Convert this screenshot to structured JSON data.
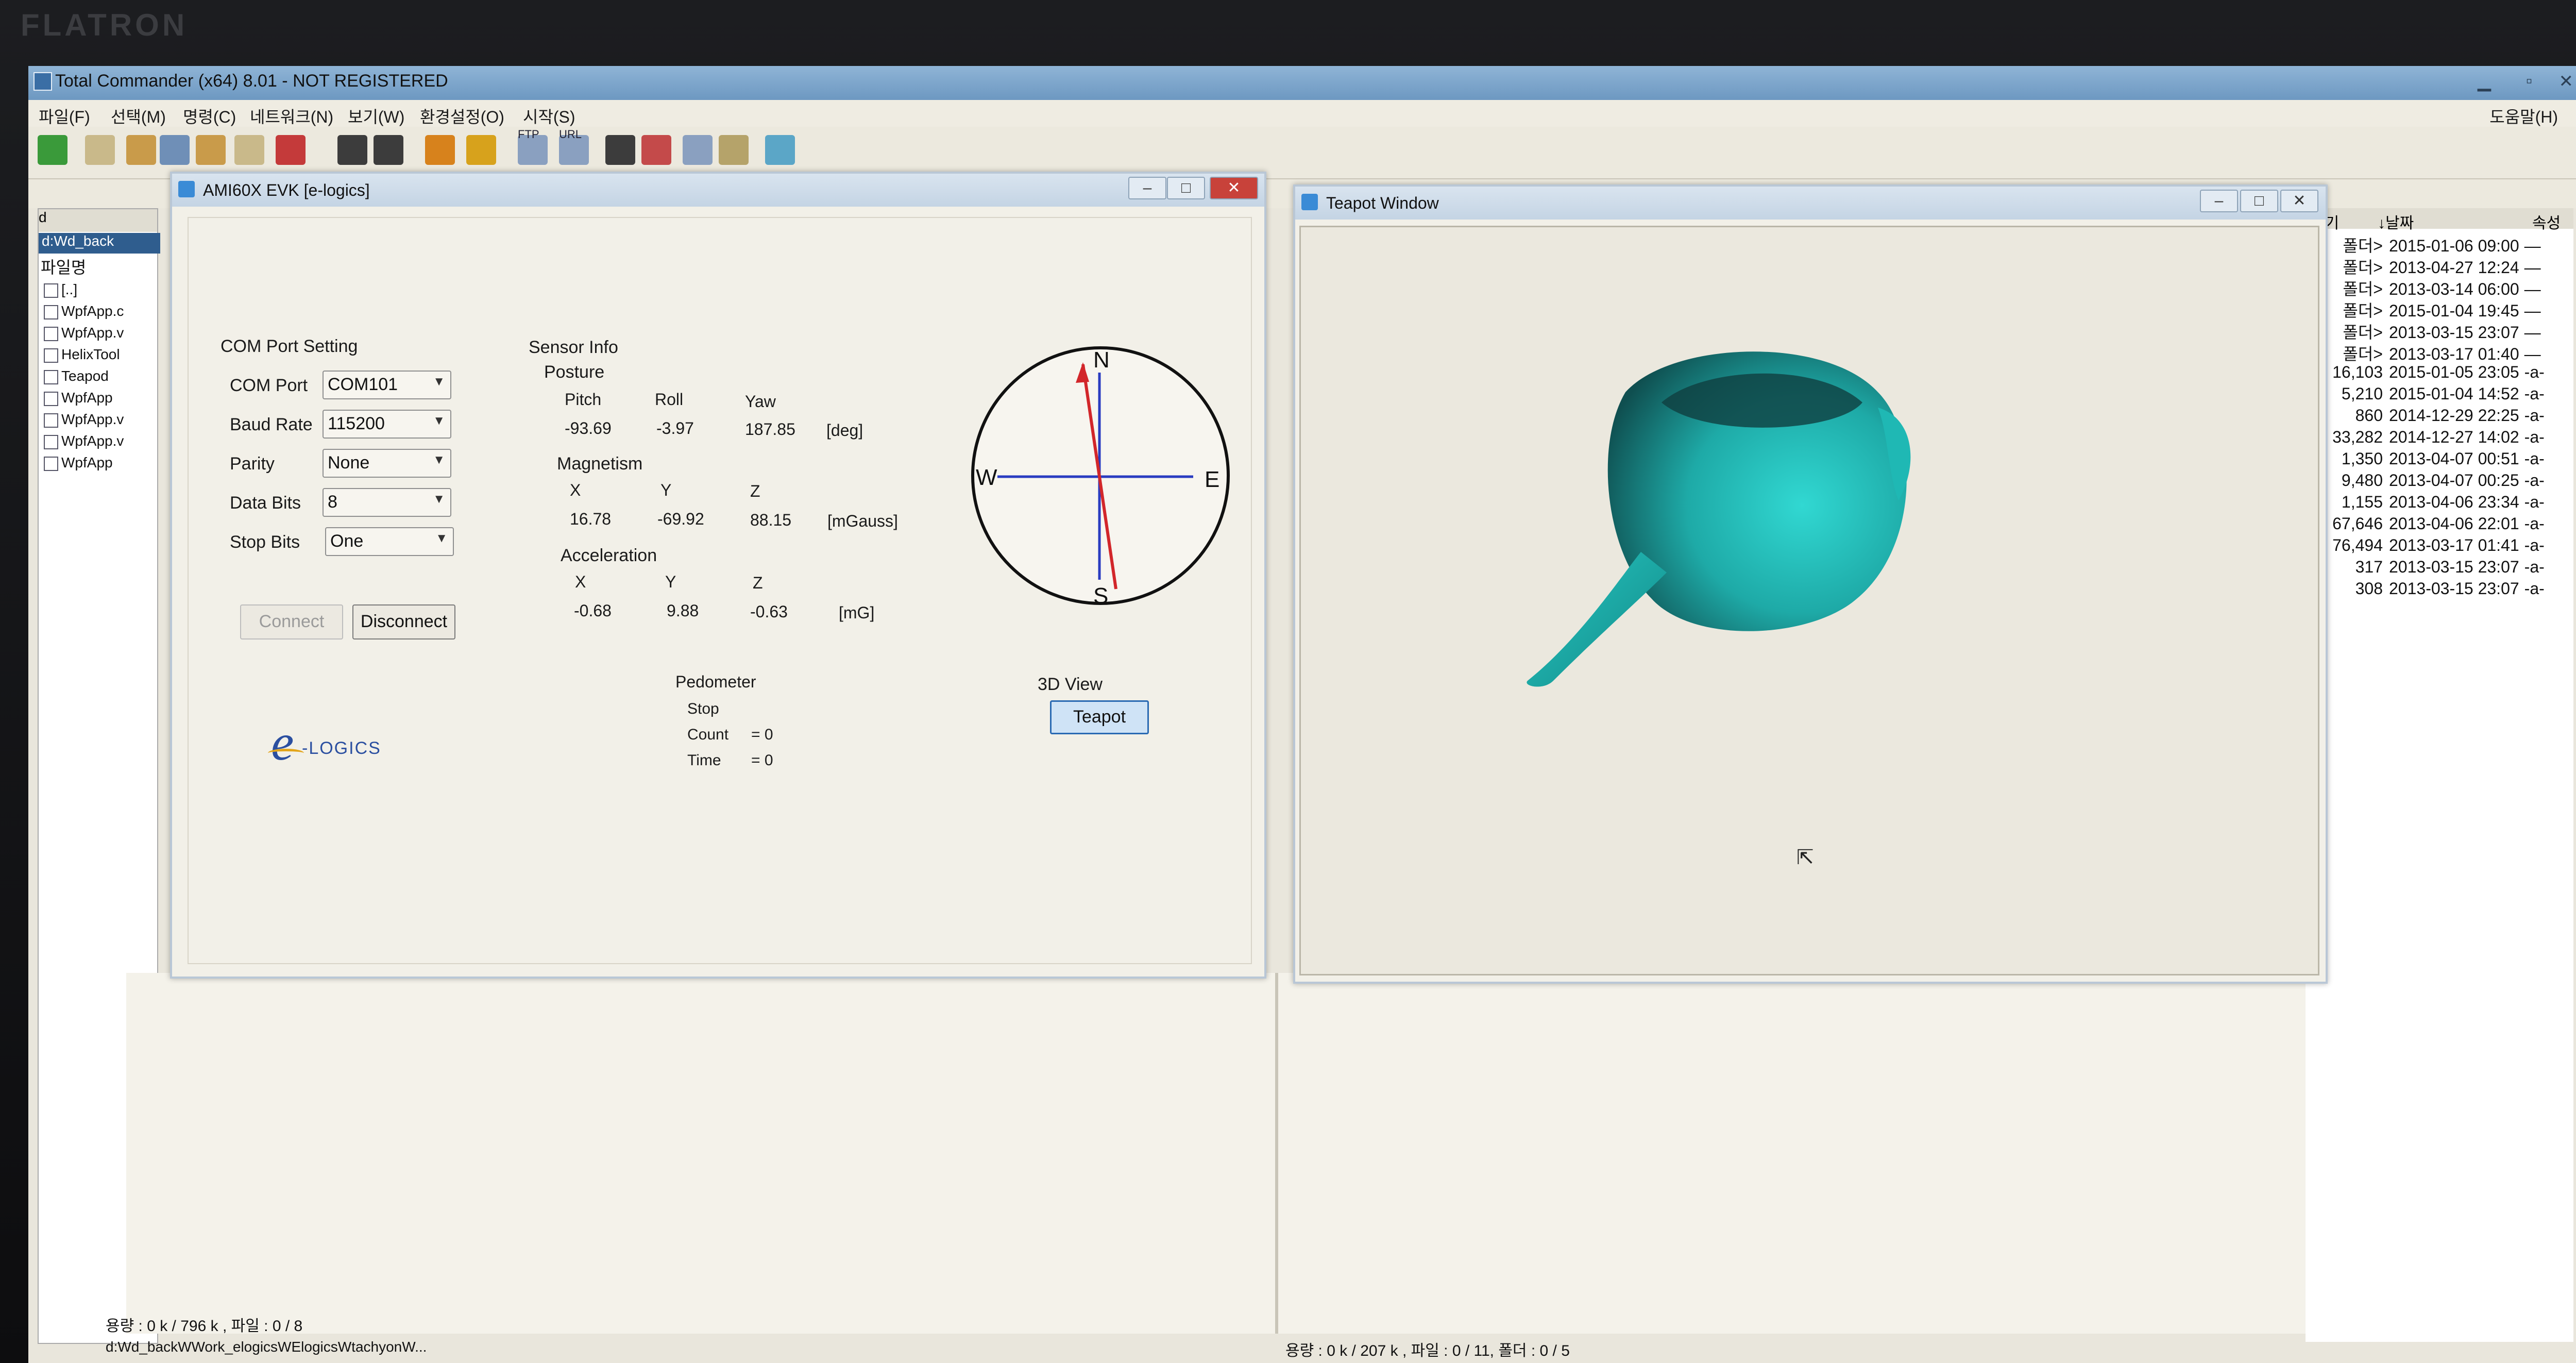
{
  "monitor": {
    "brand": "FLATRON"
  },
  "total_commander": {
    "title": "Total Commander (x64) 8.01 - NOT REGISTERED",
    "menu": [
      "파일(F)",
      "선택(M)",
      "명령(C)",
      "네트워크(N)",
      "보기(W)",
      "환경설정(O)",
      "시작(S)"
    ],
    "help": "도움말(H)",
    "ftp_label": "FTP",
    "url_label": "URL",
    "left_panel": {
      "drive": "d",
      "path": "d:Wd_back",
      "column": "파일명",
      "files": [
        "[..]",
        "WpfApp.c",
        "WpfApp.v",
        "HelixTool",
        "Teapod",
        "WpfApp",
        "WpfApp.v",
        "WpfApp.v",
        "WpfApp"
      ]
    },
    "right_panel": {
      "headers": {
        "size": "크기",
        "date": "↓날짜",
        "attr": "속성"
      },
      "rows": [
        {
          "size": "폴더>",
          "date": "2015-01-06 09:00",
          "attr": "—"
        },
        {
          "size": "폴더>",
          "date": "2013-04-27 12:24",
          "attr": "—"
        },
        {
          "size": "폴더>",
          "date": "2013-03-14 06:00",
          "attr": "—"
        },
        {
          "size": "폴더>",
          "date": "2015-01-04 19:45",
          "attr": "—"
        },
        {
          "size": "폴더>",
          "date": "2013-03-15 23:07",
          "attr": "—"
        },
        {
          "size": "폴더>",
          "date": "2013-03-17 01:40",
          "attr": "—"
        },
        {
          "size": "16,103",
          "date": "2015-01-05 23:05",
          "attr": "-a-"
        },
        {
          "size": "5,210",
          "date": "2015-01-04 14:52",
          "attr": "-a-"
        },
        {
          "size": "860",
          "date": "2014-12-29 22:25",
          "attr": "-a-"
        },
        {
          "size": "33,282",
          "date": "2014-12-27 14:02",
          "attr": "-a-"
        },
        {
          "size": "1,350",
          "date": "2013-04-07 00:51",
          "attr": "-a-"
        },
        {
          "size": "9,480",
          "date": "2013-04-07 00:25",
          "attr": "-a-"
        },
        {
          "size": "1,155",
          "date": "2013-04-06 23:34",
          "attr": "-a-"
        },
        {
          "size": "67,646",
          "date": "2013-04-06 22:01",
          "attr": "-a-"
        },
        {
          "size": "76,494",
          "date": "2013-03-17 01:41",
          "attr": "-a-"
        },
        {
          "size": "317",
          "date": "2013-03-15 23:07",
          "attr": "-a-"
        },
        {
          "size": "308",
          "date": "2013-03-15 23:07",
          "attr": "-a-"
        }
      ]
    },
    "status_left": "용량 : 0 k / 796 k , 파일 : 0 / 8",
    "status_right": "용량 : 0 k / 207 k , 파일 : 0 / 11, 폴더 : 0 / 5",
    "command_line": "d:Wd_backWWork_elogicsWElogicsWtachyonW..."
  },
  "ami": {
    "title": "AMI60X EVK [e-logics]",
    "com_section": "COM Port Setting",
    "com_port": {
      "label": "COM Port",
      "value": "COM101"
    },
    "baud_rate": {
      "label": "Baud Rate",
      "value": "115200"
    },
    "parity": {
      "label": "Parity",
      "value": "None"
    },
    "data_bits": {
      "label": "Data Bits",
      "value": "8"
    },
    "stop_bits": {
      "label": "Stop Bits",
      "value": "One"
    },
    "connect": "Connect",
    "disconnect": "Disconnect",
    "logo_e": "e",
    "logo_rest": "-LOGICS",
    "sensor_info": "Sensor Info",
    "posture": {
      "title": "Posture",
      "h1": "Pitch",
      "h2": "Roll",
      "h3": "Yaw",
      "v1": "-93.69",
      "v2": "-3.97",
      "v3": "187.85",
      "unit": "[deg]"
    },
    "magnetism": {
      "title": "Magnetism",
      "h1": "X",
      "h2": "Y",
      "h3": "Z",
      "v1": "16.78",
      "v2": "-69.92",
      "v3": "88.15",
      "unit": "[mGauss]"
    },
    "acceleration": {
      "title": "Acceleration",
      "h1": "X",
      "h2": "Y",
      "h3": "Z",
      "v1": "-0.68",
      "v2": "9.88",
      "v3": "-0.63",
      "unit": "[mG]"
    },
    "pedometer": {
      "title": "Pedometer",
      "state": "Stop",
      "count_label": "Count",
      "count_value": "= 0",
      "time_label": "Time",
      "time_value": "= 0"
    },
    "compass": {
      "n": "N",
      "s": "S",
      "e": "E",
      "w": "W"
    },
    "view3d": "3D View",
    "teapot_button": "Teapot"
  },
  "teapot_window": {
    "title": "Teapot Window"
  },
  "colors": {
    "teapot": "#1fb8b4",
    "needle": "#d2262a",
    "axis": "#2a3cc0"
  }
}
